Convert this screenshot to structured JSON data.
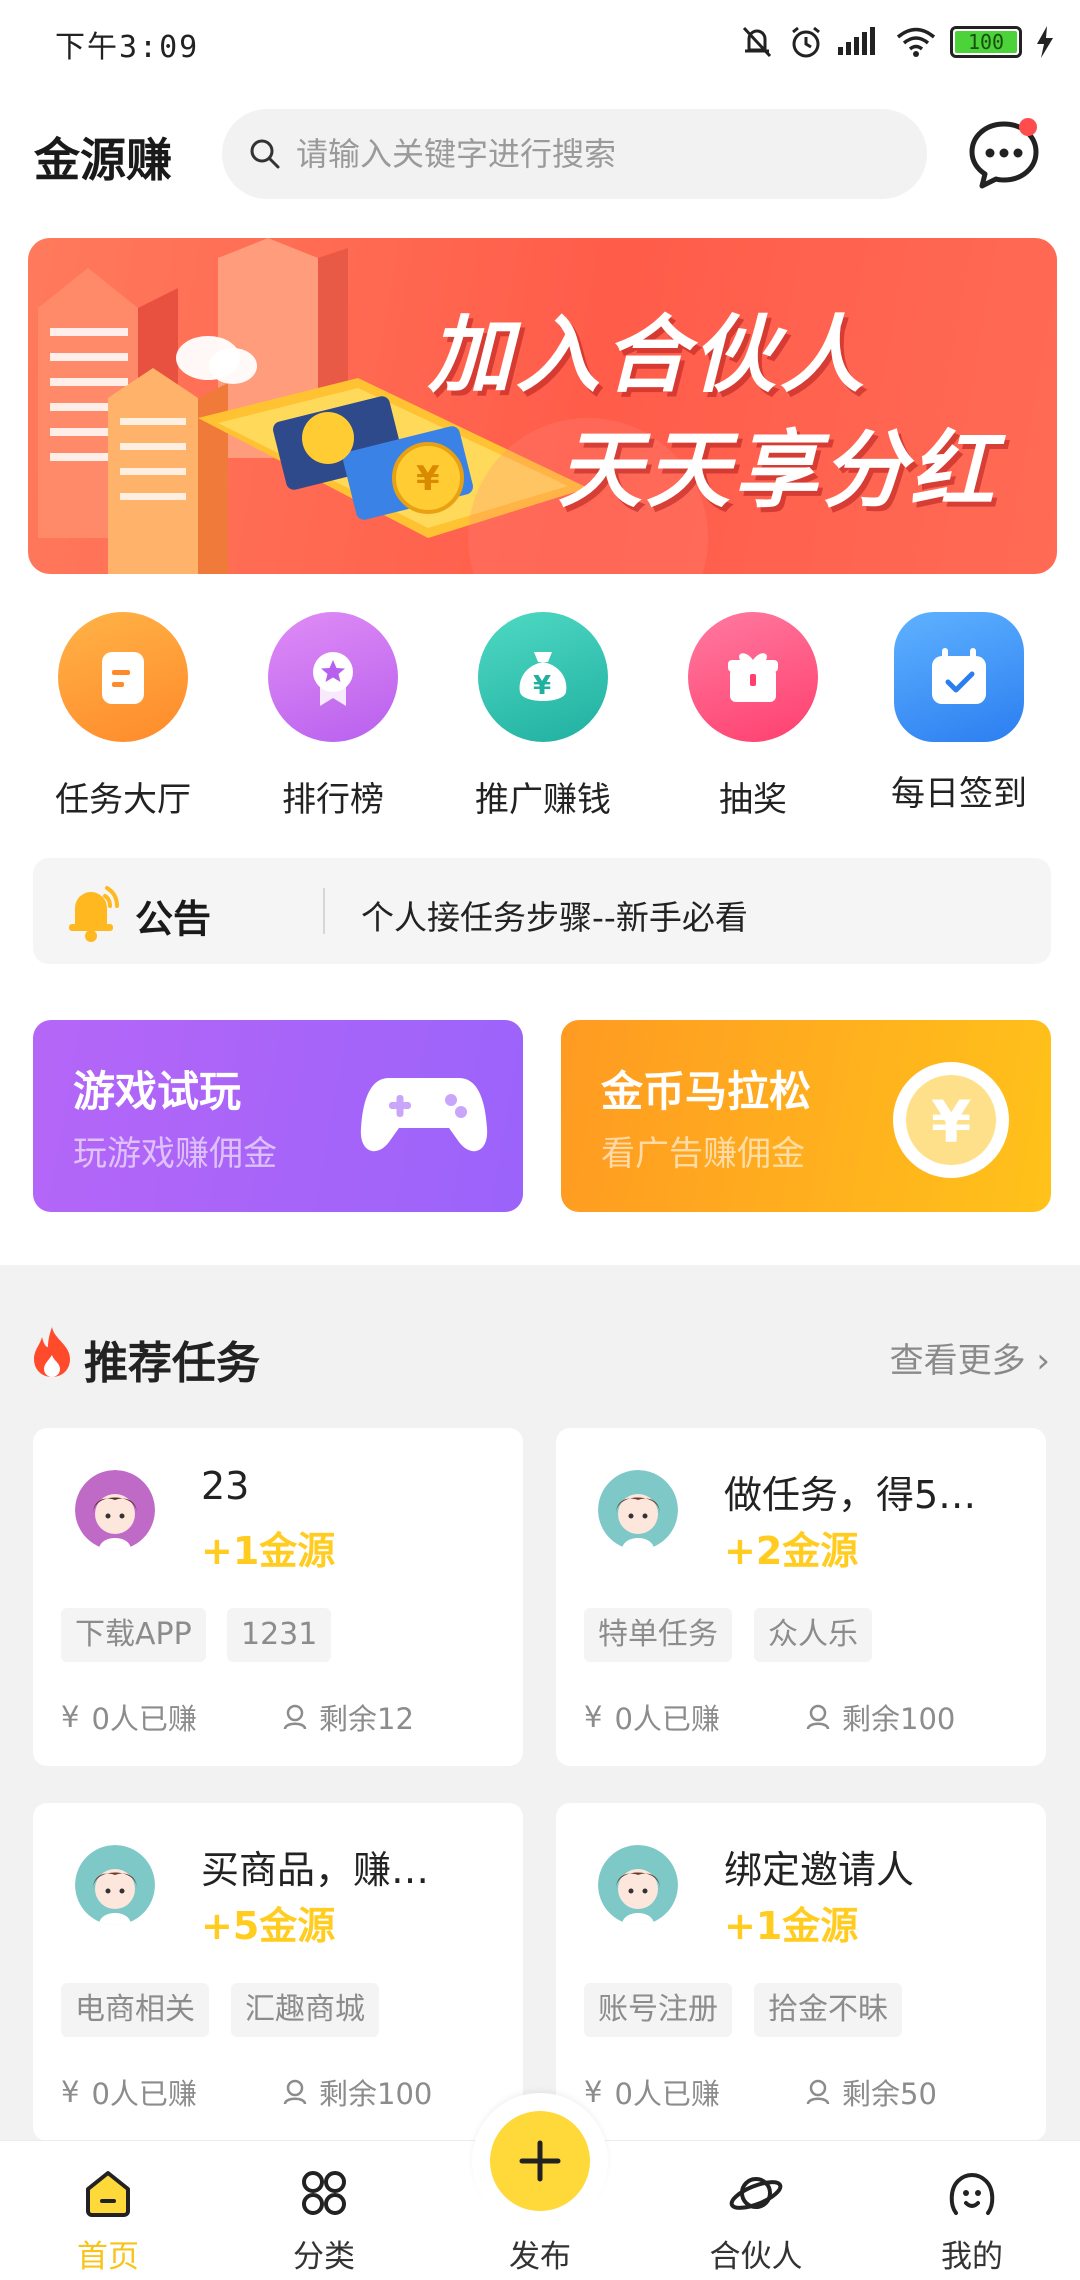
{
  "status_bar": {
    "time": "下午3:09",
    "battery": "100"
  },
  "header": {
    "app_title": "金源赚",
    "search_placeholder": "请输入关键字进行搜索"
  },
  "banner": {
    "line1": "加入合伙人",
    "line2": "天天享分红",
    "accent": "#ff5c4a"
  },
  "quick_nav": [
    {
      "label": "任务大厅",
      "icon": "task-hall-icon",
      "color": "#ff9933"
    },
    {
      "label": "排行榜",
      "icon": "ranking-icon",
      "color": "#c06af0"
    },
    {
      "label": "推广赚钱",
      "icon": "money-bag-icon",
      "color": "#2bbfae"
    },
    {
      "label": "抽奖",
      "icon": "gift-icon",
      "color": "#ff4d7a"
    },
    {
      "label": "每日签到",
      "icon": "calendar-check-icon",
      "color": "#3b8cf6"
    }
  ],
  "notice": {
    "title": "公告",
    "text": "个人接任务步骤--新手必看"
  },
  "promos": [
    {
      "title": "游戏试玩",
      "subtitle": "玩游戏赚佣金",
      "icon": "gamepad-icon"
    },
    {
      "title": "金币马拉松",
      "subtitle": "看广告赚佣金",
      "icon": "yuan-coin-icon"
    }
  ],
  "recommended": {
    "title": "推荐任务",
    "more": "查看更多",
    "tasks": [
      {
        "title": "23",
        "reward": "+1金源",
        "tags": [
          "下载APP",
          "1231"
        ],
        "earned": "0人已赚",
        "remaining": "剩余12"
      },
      {
        "title": "做任务，得5…",
        "reward": "+2金源",
        "tags": [
          "特单任务",
          "众人乐"
        ],
        "earned": "0人已赚",
        "remaining": "剩余100"
      },
      {
        "title": "买商品，赚…",
        "reward": "+5金源",
        "tags": [
          "电商相关",
          "汇趣商城"
        ],
        "earned": "0人已赚",
        "remaining": "剩余100"
      },
      {
        "title": "绑定邀请人",
        "reward": "+1金源",
        "tags": [
          "账号注册",
          "拾金不昧"
        ],
        "earned": "0人已赚",
        "remaining": "剩余50"
      }
    ]
  },
  "bottom_nav": [
    {
      "label": "首页",
      "icon": "home-icon",
      "active": true
    },
    {
      "label": "分类",
      "icon": "category-icon",
      "active": false
    },
    {
      "label": "发布",
      "icon": "plus-icon",
      "active": false
    },
    {
      "label": "合伙人",
      "icon": "planet-icon",
      "active": false
    },
    {
      "label": "我的",
      "icon": "profile-icon",
      "active": false
    }
  ],
  "colors": {
    "accent_yellow": "#ffcc1f",
    "nav_active": "#f7c41b",
    "notification_dot": "#ff4d4d"
  }
}
